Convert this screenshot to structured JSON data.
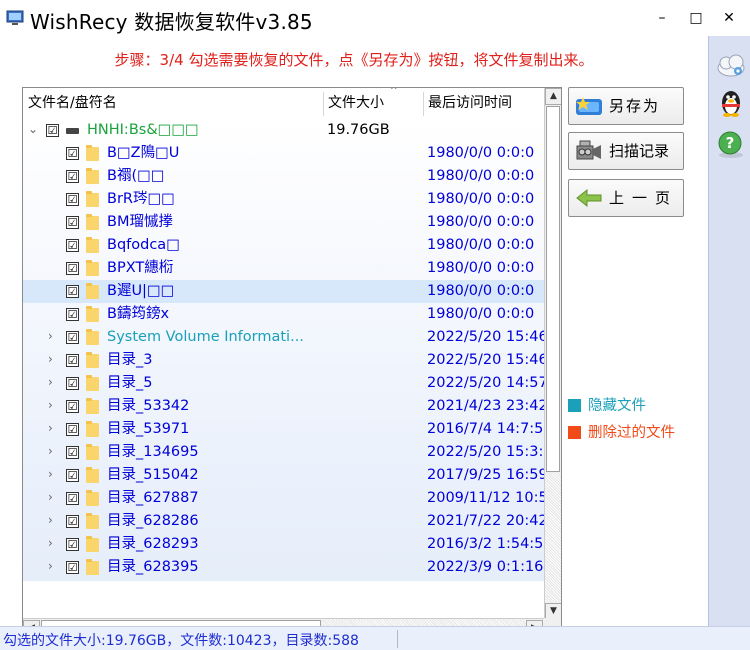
{
  "window": {
    "title": "WishRecy 数据恢复软件v3.85",
    "controls": {
      "minimize": "–",
      "maximize": "□",
      "close": "✕"
    }
  },
  "step_text": "步骤：3/4 勾选需要恢复的文件，点《另存为》按钮，将文件复制出来。",
  "tree": {
    "columns": {
      "name": "文件名/盘符名",
      "size": "文件大小",
      "time": "最后访问时间"
    },
    "rows": [
      {
        "level": 0,
        "expander": "⌄",
        "checked": "☑",
        "icon": "drive",
        "name": "HNHI:Bs&□□□",
        "size": "19.76GB",
        "time": "",
        "name_color": "#1aa33c",
        "selected": false
      },
      {
        "level": 1,
        "expander": "",
        "checked": "☑",
        "icon": "folder",
        "name": "B□Z隝□U",
        "size": "",
        "time": "1980/0/0 0:0:0",
        "name_color": "#0000d8",
        "selected": false
      },
      {
        "level": 1,
        "expander": "",
        "checked": "☑",
        "icon": "folder",
        "name": "B禤(□□",
        "size": "",
        "time": "1980/0/0 0:0:0",
        "name_color": "#0000d8",
        "selected": false
      },
      {
        "level": 1,
        "expander": "",
        "checked": "☑",
        "icon": "folder",
        "name": "BrR琌□□",
        "size": "",
        "time": "1980/0/0 0:0:0",
        "name_color": "#0000d8",
        "selected": false
      },
      {
        "level": 1,
        "expander": "",
        "checked": "☑",
        "icon": "folder",
        "name": "BM瑠慽搼",
        "size": "",
        "time": "1980/0/0 0:0:0",
        "name_color": "#0000d8",
        "selected": false
      },
      {
        "level": 1,
        "expander": "",
        "checked": "☑",
        "icon": "folder",
        "name": "Bqfodca□",
        "size": "",
        "time": "1980/0/0 0:0:0",
        "name_color": "#0000d8",
        "selected": false
      },
      {
        "level": 1,
        "expander": "",
        "checked": "☑",
        "icon": "folder",
        "name": "BPXT繐椼",
        "size": "",
        "time": "1980/0/0 0:0:0",
        "name_color": "#0000d8",
        "selected": false
      },
      {
        "level": 1,
        "expander": "",
        "checked": "☑",
        "icon": "folder",
        "name": "B遲U|□□",
        "size": "",
        "time": "1980/0/0 0:0:0",
        "name_color": "#0000d8",
        "selected": true
      },
      {
        "level": 1,
        "expander": "",
        "checked": "☑",
        "icon": "folder",
        "name": "B鑄筠鎊x",
        "size": "",
        "time": "1980/0/0 0:0:0",
        "name_color": "#0000d8",
        "selected": false
      },
      {
        "level": 1,
        "expander": "›",
        "checked": "☑",
        "icon": "folder",
        "name": "System Volume Informati...",
        "size": "",
        "time": "2022/5/20 15:46",
        "name_color": "#1aa0b8",
        "selected": false
      },
      {
        "level": 1,
        "expander": "›",
        "checked": "☑",
        "icon": "folder",
        "name": "目录_3",
        "size": "",
        "time": "2022/5/20 15:46",
        "name_color": "#0000d8",
        "selected": false
      },
      {
        "level": 1,
        "expander": "›",
        "checked": "☑",
        "icon": "folder",
        "name": "目录_5",
        "size": "",
        "time": "2022/5/20 14:57",
        "name_color": "#0000d8",
        "selected": false
      },
      {
        "level": 1,
        "expander": "›",
        "checked": "☑",
        "icon": "folder",
        "name": "目录_53342",
        "size": "",
        "time": "2021/4/23 23:42",
        "name_color": "#0000d8",
        "selected": false
      },
      {
        "level": 1,
        "expander": "›",
        "checked": "☑",
        "icon": "folder",
        "name": "目录_53971",
        "size": "",
        "time": "2016/7/4 14:7:5",
        "name_color": "#0000d8",
        "selected": false
      },
      {
        "level": 1,
        "expander": "›",
        "checked": "☑",
        "icon": "folder",
        "name": "目录_134695",
        "size": "",
        "time": "2022/5/20 15:3:",
        "name_color": "#0000d8",
        "selected": false
      },
      {
        "level": 1,
        "expander": "›",
        "checked": "☑",
        "icon": "folder",
        "name": "目录_515042",
        "size": "",
        "time": "2017/9/25 16:59",
        "name_color": "#0000d8",
        "selected": false
      },
      {
        "level": 1,
        "expander": "›",
        "checked": "☑",
        "icon": "folder",
        "name": "目录_627887",
        "size": "",
        "time": "2009/11/12 10:5",
        "name_color": "#0000d8",
        "selected": false
      },
      {
        "level": 1,
        "expander": "›",
        "checked": "☑",
        "icon": "folder",
        "name": "目录_628286",
        "size": "",
        "time": "2021/7/22 20:42",
        "name_color": "#0000d8",
        "selected": false
      },
      {
        "level": 1,
        "expander": "›",
        "checked": "☑",
        "icon": "folder",
        "name": "目录_628293",
        "size": "",
        "time": "2016/3/2 1:54:5",
        "name_color": "#0000d8",
        "selected": false
      },
      {
        "level": 1,
        "expander": "›",
        "checked": "☑",
        "icon": "folder",
        "name": "目录_628395",
        "size": "",
        "time": "2022/3/9 0:1:16",
        "name_color": "#0000d8",
        "selected": false
      }
    ]
  },
  "buttons": {
    "save_as": "另存为",
    "scan_record": "扫描记录",
    "prev_page": "上一页"
  },
  "legend": {
    "hidden_files": {
      "label": "隐藏文件",
      "color": "#1aa0b8"
    },
    "deleted_files": {
      "label": "删除过的文件",
      "color": "#f04b18"
    }
  },
  "sidebar": {
    "icons": [
      "cloud-gear-icon",
      "qq-penguin-icon",
      "help-icon"
    ]
  },
  "status": "勾选的文件大小:19.76GB，文件数:10423，目录数:588"
}
